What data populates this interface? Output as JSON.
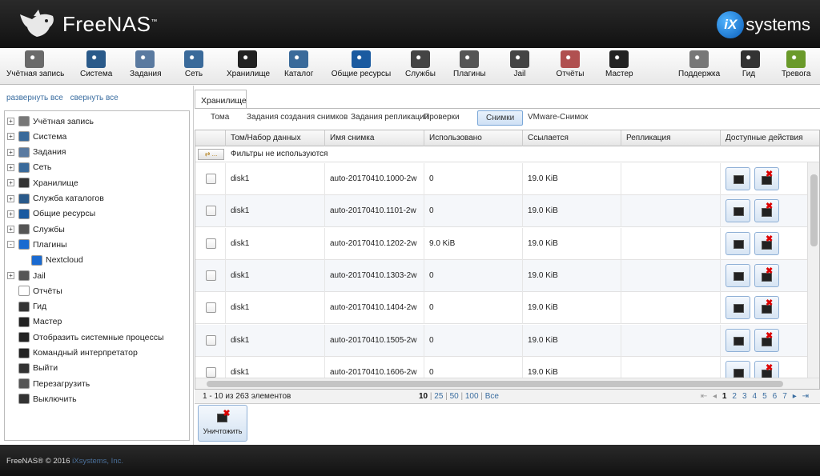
{
  "header": {
    "brand": "FreeNAS",
    "brand_tm": "™",
    "vendor_badge": "iX",
    "vendor_text": "systems"
  },
  "toolbar": [
    {
      "label": "Учётная запись",
      "icon": "users-icon"
    },
    {
      "label": "Система",
      "icon": "system-icon"
    },
    {
      "label": "Задания",
      "icon": "tasks-icon"
    },
    {
      "label": "Сеть",
      "icon": "network-icon"
    },
    {
      "label": "Хранилище",
      "icon": "storage-icon"
    },
    {
      "label": "Каталог",
      "icon": "directory-icon"
    },
    {
      "label": "Общие ресурсы",
      "icon": "sharing-icon"
    },
    {
      "label": "Службы",
      "icon": "services-icon"
    },
    {
      "label": "Плагины",
      "icon": "plugins-icon"
    },
    {
      "label": "Jail",
      "icon": "jail-icon"
    },
    {
      "label": "Отчёты",
      "icon": "reports-icon"
    },
    {
      "label": "Мастер",
      "icon": "wizard-icon"
    },
    {
      "label": "Поддержка",
      "icon": "support-icon"
    },
    {
      "label": "Гид",
      "icon": "guide-icon"
    },
    {
      "label": "Тревога",
      "icon": "alert-icon"
    }
  ],
  "sidebar": {
    "expand_all": "развернуть все",
    "collapse_all": "свернуть все",
    "items": [
      {
        "label": "Учётная запись",
        "exp": "+",
        "indent": 0
      },
      {
        "label": "Система",
        "exp": "+",
        "indent": 0
      },
      {
        "label": "Задания",
        "exp": "+",
        "indent": 0
      },
      {
        "label": "Сеть",
        "exp": "+",
        "indent": 0
      },
      {
        "label": "Хранилище",
        "exp": "+",
        "indent": 0
      },
      {
        "label": "Служба каталогов",
        "exp": "+",
        "indent": 0
      },
      {
        "label": "Общие ресурсы",
        "exp": "+",
        "indent": 0
      },
      {
        "label": "Службы",
        "exp": "+",
        "indent": 0
      },
      {
        "label": "Плагины",
        "exp": "-",
        "indent": 0
      },
      {
        "label": "Nextcloud",
        "exp": "",
        "indent": 1
      },
      {
        "label": "Jail",
        "exp": "+",
        "indent": 0
      },
      {
        "label": "Отчёты",
        "exp": "",
        "indent": 0
      },
      {
        "label": "Гид",
        "exp": "",
        "indent": 0
      },
      {
        "label": "Мастер",
        "exp": "",
        "indent": 0
      },
      {
        "label": "Отобразить системные процессы",
        "exp": "",
        "indent": 0
      },
      {
        "label": "Командный интерпретатор",
        "exp": "",
        "indent": 0
      },
      {
        "label": "Выйти",
        "exp": "",
        "indent": 0
      },
      {
        "label": "Перезагрузить",
        "exp": "",
        "indent": 0
      },
      {
        "label": "Выключить",
        "exp": "",
        "indent": 0
      }
    ]
  },
  "main": {
    "top_tab": "Хранилище",
    "subtabs": [
      "Тома",
      "Задания создания снимков",
      "Задания репликации",
      "Проверки",
      "Снимки",
      "VMware-Снимок"
    ],
    "active_subtab": "Снимки",
    "columns": [
      "Том/Набор данных",
      "Имя снимка",
      "Использовано",
      "Ссылается",
      "Репликация",
      "Доступные действия"
    ],
    "filter_button": "...",
    "filter_text": "Фильтры не используются",
    "rows": [
      {
        "dataset": "disk1",
        "name": "auto-20170410.1000-2w",
        "used": "0",
        "refer": "19.0 KiB",
        "replication": ""
      },
      {
        "dataset": "disk1",
        "name": "auto-20170410.1101-2w",
        "used": "0",
        "refer": "19.0 KiB",
        "replication": ""
      },
      {
        "dataset": "disk1",
        "name": "auto-20170410.1202-2w",
        "used": "9.0 KiB",
        "refer": "19.0 KiB",
        "replication": ""
      },
      {
        "dataset": "disk1",
        "name": "auto-20170410.1303-2w",
        "used": "0",
        "refer": "19.0 KiB",
        "replication": ""
      },
      {
        "dataset": "disk1",
        "name": "auto-20170410.1404-2w",
        "used": "0",
        "refer": "19.0 KiB",
        "replication": ""
      },
      {
        "dataset": "disk1",
        "name": "auto-20170410.1505-2w",
        "used": "0",
        "refer": "19.0 KiB",
        "replication": ""
      },
      {
        "dataset": "disk1",
        "name": "auto-20170410.1606-2w",
        "used": "0",
        "refer": "19.0 KiB",
        "replication": ""
      }
    ],
    "pager": {
      "info": "1 - 10 из 263 элементов",
      "sizes": [
        "10",
        "25",
        "50",
        "100",
        "Все"
      ],
      "selected_size": "10",
      "pages": [
        "1",
        "2",
        "3",
        "4",
        "5",
        "6",
        "7"
      ],
      "current_page": "1"
    },
    "destroy_label": "Уничтожить"
  },
  "footer": {
    "copyright": "FreeNAS® © 2016",
    "company": "iXsystems, Inc."
  },
  "colors": {
    "link": "#3a6da0",
    "header_bg": "#1a1a1a",
    "button_border": "#8fb0d6"
  }
}
